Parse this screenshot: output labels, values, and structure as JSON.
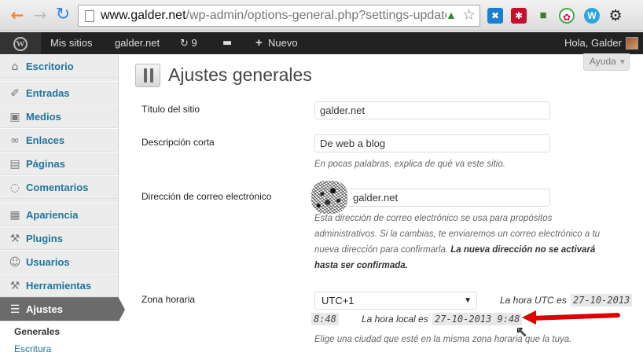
{
  "browser": {
    "url_host": "www.galder.net",
    "url_path": "/wp-admin/options-general.php?settings-updated",
    "icons": [
      "back-arrow-icon",
      "forward-arrow-icon",
      "reload-icon",
      "page-icon",
      "star-icon",
      "wrench-icon"
    ]
  },
  "adminbar": {
    "sites": "Mis sitios",
    "site": "galder.net",
    "updates_count": "9",
    "new_label": "Nuevo",
    "hello": "Hola, Galder"
  },
  "sidebar": {
    "items": [
      {
        "label": "Escritorio"
      },
      {
        "label": "Entradas"
      },
      {
        "label": "Medios"
      },
      {
        "label": "Enlaces"
      },
      {
        "label": "Páginas"
      },
      {
        "label": "Comentarios"
      },
      {
        "label": "Apariencia"
      },
      {
        "label": "Plugins"
      },
      {
        "label": "Usuarios"
      },
      {
        "label": "Herramientas"
      },
      {
        "label": "Ajustes"
      }
    ],
    "submenu": {
      "current": "Generales",
      "next": "Escritura"
    }
  },
  "help_label": "Ayuda",
  "page_title": "Ajustes generales",
  "form": {
    "site_title_label": "Título del sitio",
    "site_title_value": "galder.net",
    "tagline_label": "Descripción corta",
    "tagline_value": "De web a blog",
    "tagline_desc": "En pocas palabras, explica de qué va este sitio.",
    "email_label": "Dirección de correo electrónico",
    "email_value": "galder.net",
    "email_desc_1": "Esta dirección de correo electrónico se usa para propósitos",
    "email_desc_2": "administrativos. Si la cambias, te enviaremos un correo electrónico a tu",
    "email_desc_3": "nueva dirección para confirmarla.",
    "email_desc_bold_1": "La nueva dirección no se activará",
    "email_desc_bold_2": "hasta ser confirmada.",
    "timezone_label": "Zona horaria",
    "timezone_value": "UTC+1",
    "utc_label": "La hora UTC es",
    "utc_date": "27-10-2013",
    "utc_time": "8:48",
    "local_label": "La hora local es",
    "local_datetime": "27-10-2013 9:48",
    "timezone_desc": "Elige una ciudad que esté en la misma zona horaria que la tuya."
  },
  "annotation_color": "#e00000"
}
